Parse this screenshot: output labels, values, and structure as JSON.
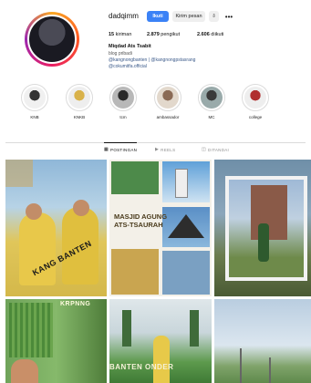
{
  "profile": {
    "username": "dadqimm",
    "follow_label": "Ikuti",
    "message_label": "Kirim pesan",
    "add_icon": "add-person-icon",
    "more_icon": "more-icon"
  },
  "stats": {
    "posts_count": "15",
    "posts_label": "kiriman",
    "followers_count": "2.879",
    "followers_label": "pengikut",
    "following_count": "2.606",
    "following_label": "diikuti"
  },
  "bio": {
    "name": "Miqdad Ats Tsabit",
    "line1": "blog pribadi",
    "line2": "@kangnongbanten | @kangnongpstasrang",
    "line3": "@cokumitfa.official"
  },
  "highlights": [
    {
      "label": "KNB"
    },
    {
      "label": "KNKB"
    },
    {
      "label": "tcm"
    },
    {
      "label": "ambassador"
    },
    {
      "label": "MC"
    },
    {
      "label": "college"
    }
  ],
  "tabs": [
    {
      "label": "POSTINGAN",
      "icon": "grid-icon"
    },
    {
      "label": "REELS",
      "icon": "reels-icon"
    },
    {
      "label": "DITANDAI",
      "icon": "tagged-icon"
    }
  ],
  "grid": {
    "post1_text": "KANG BANTEN",
    "post2_title_line1": "MASJID AGUNG",
    "post2_title_line2": "ATS-TSAURAH",
    "post3_caption": "",
    "post4_heading": "KRPNNG",
    "post5_text": "BANTEN  ONDER"
  },
  "colors": {
    "accent": "#3b82f6",
    "ring": "#e91e63"
  }
}
